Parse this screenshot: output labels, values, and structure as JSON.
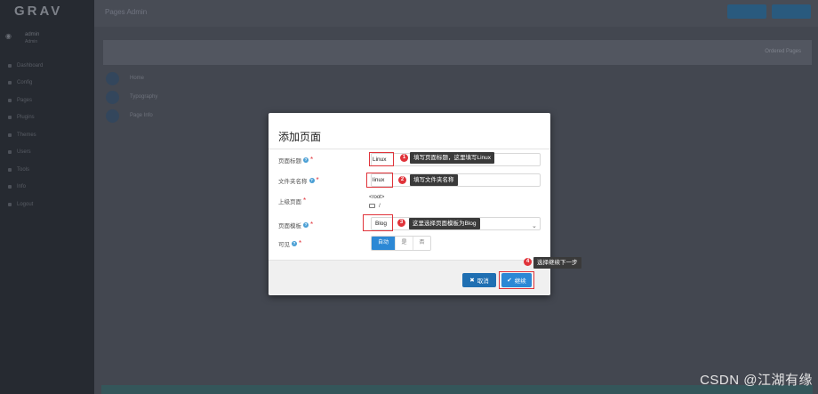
{
  "app": {
    "logo": "GRAV",
    "user_name": "admin",
    "user_role": "Admin",
    "page_heading": "Pages Admin",
    "sort_label": "Ordered Pages"
  },
  "nav_items": [
    "Dashboard",
    "Config",
    "Pages",
    "Plugins",
    "Themes",
    "Users",
    "Tools",
    "Info",
    "Logout"
  ],
  "pages": [
    "Home",
    "Typography",
    "Page Info"
  ],
  "modal": {
    "title": "添加页面",
    "fields": {
      "title_label": "页面标题",
      "title_value": "Linux",
      "folder_label": "文件夹名称",
      "folder_value": "linux",
      "parent_label": "上级页面",
      "parent_root": "<root>",
      "parent_path": "/",
      "template_label": "页面模板",
      "template_value": "Blog",
      "visible_label": "可见",
      "visible_options": [
        "自动",
        "是",
        "否"
      ]
    },
    "buttons": {
      "cancel": "取消",
      "continue": "继续"
    }
  },
  "annotations": [
    {
      "num": "1",
      "text": "填写页面标题，这里填写Linux"
    },
    {
      "num": "2",
      "text": "填写文件夹名称"
    },
    {
      "num": "3",
      "text": "这里选择页面模板为Blog"
    },
    {
      "num": "4",
      "text": "选择继续下一步"
    }
  ],
  "watermark": "CSDN @江湖有缘",
  "colors": {
    "accent": "#2c88d5",
    "annotation_red": "#e0333a",
    "tooltip_bg": "#3a3a3a"
  }
}
